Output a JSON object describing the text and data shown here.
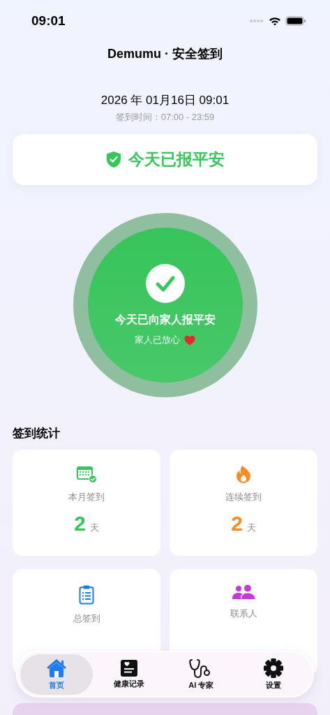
{
  "status_bar": {
    "time": "09:01"
  },
  "header": {
    "title": "Demumu · 安全签到"
  },
  "datetime": {
    "date": "2026 年 01月16日 09:01",
    "window": "签到时间：07:00 - 23:59"
  },
  "status_banner": {
    "text": "今天已报平安"
  },
  "checkin_circle": {
    "checked": true,
    "title": "今天已向家人报平安",
    "subtitle": "家人已放心"
  },
  "stats": {
    "title": "签到统计",
    "cards": [
      {
        "kind": "calendar",
        "color": "#34c759",
        "label": "本月签到",
        "value": "2",
        "unit": "天"
      },
      {
        "kind": "flame",
        "color": "#ff8a1f",
        "label": "连续签到",
        "value": "2",
        "unit": "天"
      },
      {
        "kind": "clipboard",
        "color": "#1e7cf2",
        "label": "总签到"
      },
      {
        "kind": "people",
        "color": "#c33ad8",
        "label": "联系人"
      }
    ]
  },
  "tab_bar": [
    {
      "kind": "home",
      "label": "首页",
      "selected": true
    },
    {
      "kind": "record",
      "label": "健康记录",
      "selected": false
    },
    {
      "kind": "stethoscope",
      "label": "AI 专家",
      "selected": false
    },
    {
      "kind": "gear",
      "label": "设置",
      "selected": false
    }
  ]
}
